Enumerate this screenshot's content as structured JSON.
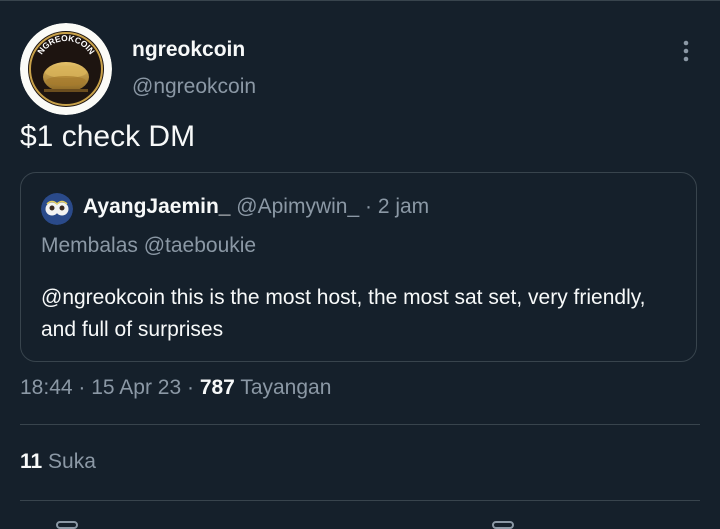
{
  "tweet": {
    "display_name": "ngreokcoin",
    "handle": "@ngreokcoin",
    "avatar_logo_text": "NGREOKCOIN",
    "text": "$1 check DM",
    "more_icon": "more-vertical-icon",
    "time": "18:44",
    "sep1": " · ",
    "date": "15 Apr 23",
    "sep2": " · ",
    "views_count": "787",
    "views_label": " Tayangan",
    "likes_count": "11",
    "likes_label": " Suka"
  },
  "quoted": {
    "display_name": "AyangJaemin_",
    "handle": "@Apimywin_",
    "sep": " · ",
    "time": "2 jam",
    "reply_prefix": "Membalas ",
    "reply_handle": "@taeboukie",
    "text": "@ngreokcoin this is the most host, the most sat set, very friendly, and full of surprises"
  },
  "colors": {
    "background": "#15202b",
    "text_primary": "#f7f9f9",
    "text_secondary": "#8b98a5",
    "border": "#38444d",
    "coin_gold": "#c9a24a"
  }
}
